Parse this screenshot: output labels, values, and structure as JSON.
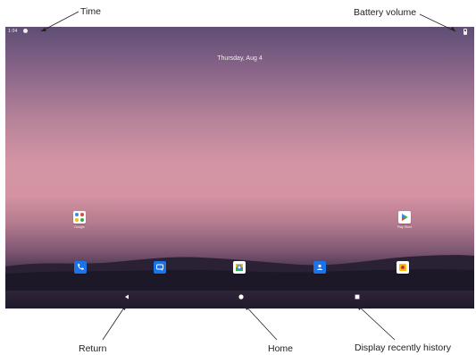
{
  "callouts": {
    "time": "Time",
    "battery": "Battery volume",
    "return": "Return",
    "home": "Home",
    "recent": "Display recently history"
  },
  "status_bar": {
    "time": "1:04",
    "notification_icon": "settings-gear-icon",
    "battery_icon": "battery-icon"
  },
  "date_widget": "Thursday, Aug 4",
  "home_apps": [
    {
      "label": "Google",
      "icon": "google-folder-icon"
    },
    {
      "label": "Play Store",
      "icon": "play-store-icon"
    }
  ],
  "dock": [
    {
      "icon": "phone-icon"
    },
    {
      "icon": "messages-icon"
    },
    {
      "icon": "photos-icon"
    },
    {
      "icon": "contacts-icon"
    },
    {
      "icon": "camera-icon"
    }
  ],
  "nav_buttons": [
    {
      "icon": "back-triangle-icon"
    },
    {
      "icon": "home-circle-icon"
    },
    {
      "icon": "recent-square-icon"
    }
  ],
  "colors": {
    "accent_blue": "#1a73e8",
    "wallpaper_top": "#5f4d74",
    "wallpaper_mid": "#d394a4",
    "wallpaper_bottom": "#1f1a2b"
  }
}
